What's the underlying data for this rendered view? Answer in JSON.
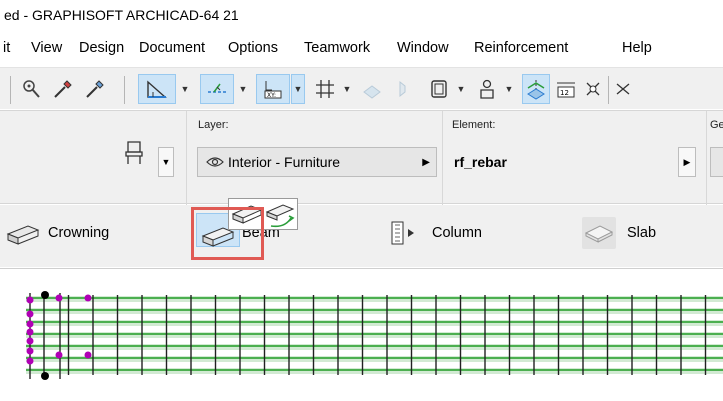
{
  "window": {
    "title": "ed - GRAPHISOFT ARCHICAD-64 21"
  },
  "menubar": {
    "items": [
      "it",
      "View",
      "Design",
      "Document",
      "Options",
      "Teamwork",
      "Window",
      "Reinforcement",
      "Help"
    ]
  },
  "toolbar": {
    "icons": [
      "magic-wand-icon",
      "eyedropper-pick-icon",
      "eyedropper-inject-icon",
      "guideline-icon",
      "snap-guide-icon",
      "coordinate-icon",
      "grid-snap-icon",
      "layer-icon",
      "hotspot-icon",
      "rectangle-icon",
      "figure-icon",
      "display-options-icon",
      "dimension-icon",
      "pin-icon",
      "intersect-icon"
    ]
  },
  "infobox": {
    "layer_label": "Layer:",
    "layer_value": "Interior - Furniture",
    "element_label": "Element:",
    "element_value": "rf_rebar",
    "cut_label": "Ge"
  },
  "toolbox": {
    "crowning_label": "Crowning",
    "beam_label": "Beam",
    "column_label": "Column",
    "slab_label": "Slab"
  },
  "colors": {
    "highlight": "#cce4f7",
    "red_outline": "#e05a54",
    "rebar_green": "#4caf50",
    "node_magenta": "#b000b5"
  }
}
